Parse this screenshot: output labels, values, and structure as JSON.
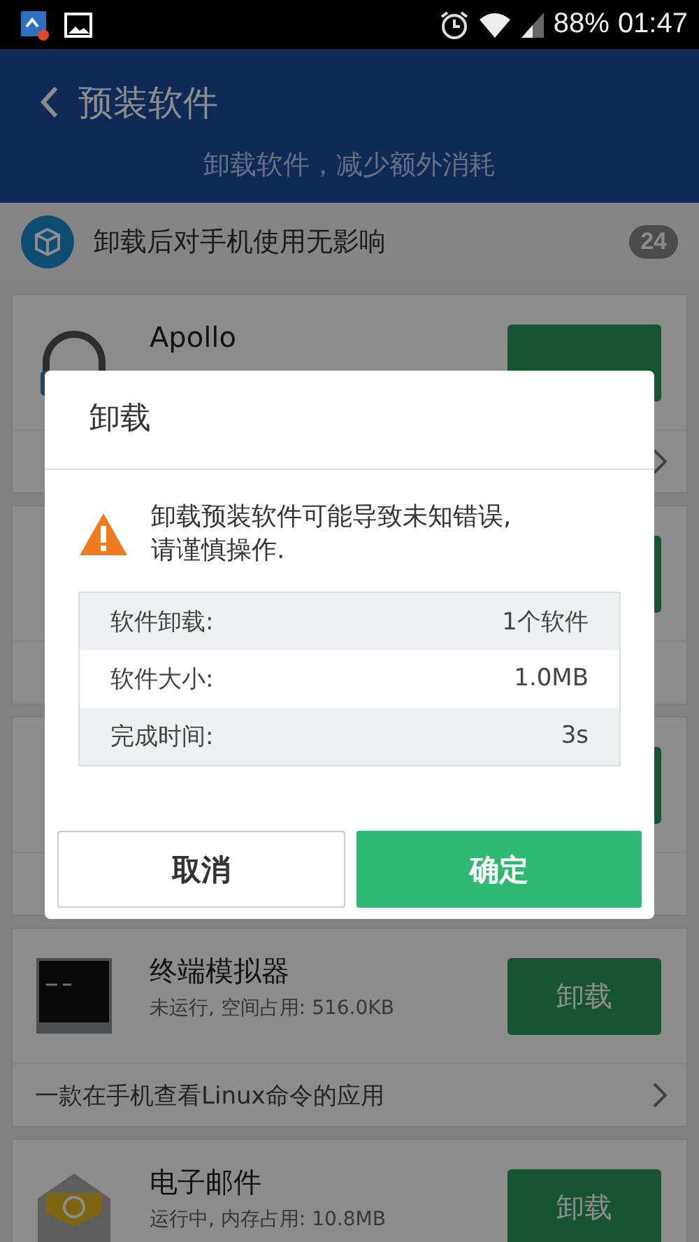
{
  "status_bar": {
    "battery": "88%",
    "time": "01:47"
  },
  "header": {
    "title": "预装软件",
    "subtitle": "卸载软件，减少额外消耗"
  },
  "notice": {
    "text": "卸载后对手机使用无影响",
    "count": "24"
  },
  "apps": [
    {
      "kind": "app",
      "name": "Apollo"
    },
    {
      "kind": "covered"
    },
    {
      "kind": "covered"
    },
    {
      "kind": "app",
      "name": "终端模拟器",
      "status": "未运行, 空间占用: 516.0KB",
      "button": "卸载",
      "description": "一款在手机查看Linux命令的应用"
    },
    {
      "kind": "app",
      "name": "电子邮件",
      "status": "运行中, 内存占用: 10.8MB",
      "button": "卸载"
    }
  ],
  "dialog": {
    "title": "卸载",
    "message": "卸载预装软件可能导致未知错误,\n请谨慎操作.",
    "rows": [
      {
        "label": "软件卸载:",
        "value": "1个软件"
      },
      {
        "label": "软件大小:",
        "value": "1.0MB"
      },
      {
        "label": "完成时间:",
        "value": "3s"
      }
    ],
    "buttons": [
      {
        "kind": "cancel",
        "label": "取消"
      },
      {
        "kind": "confirm",
        "label": "确定"
      }
    ]
  }
}
